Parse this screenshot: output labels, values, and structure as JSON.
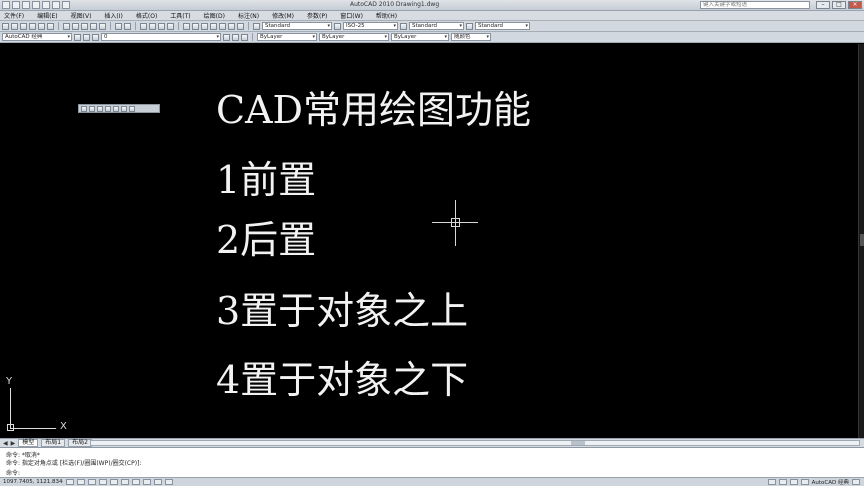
{
  "titlebar": {
    "title": "AutoCAD 2010 Drawing1.dwg",
    "search_placeholder": "键入关键字或短语"
  },
  "menu": [
    "文件(F)",
    "编辑(E)",
    "视图(V)",
    "插入(I)",
    "格式(O)",
    "工具(T)",
    "绘图(D)",
    "标注(N)",
    "修改(M)",
    "参数(P)",
    "窗口(W)",
    "帮助(H)"
  ],
  "toolbar1": {
    "text_style": "Standard",
    "dim_style": "ISO-25",
    "table_style": "Standard",
    "mleader_style": "Standard"
  },
  "toolbar2": {
    "workspace": "AutoCAD 经典",
    "layer": "0",
    "color": "ByLayer",
    "linetype": "ByLayer",
    "lineweight": "ByLayer",
    "plotstyle": "随颜色"
  },
  "canvas": {
    "line1": "CAD常用绘图功能",
    "line2": "1前置",
    "line3": "2后置",
    "line4": "3置于对象之上",
    "line5": "4置于对象之下",
    "ucs_x": "X",
    "ucs_y": "Y"
  },
  "tabs": {
    "model": "模型",
    "layout1": "布局1",
    "layout2": "布局2"
  },
  "command": {
    "line1": "命令: *取消*",
    "line2": "命令: 指定对角点或 [栏选(F)/圈围(WP)/圈交(CP)]:",
    "prompt": "命令:"
  },
  "status": {
    "coords": "1097.7405, 1121.8340",
    "workspace_label": "AutoCAD 经典"
  },
  "colors": {
    "canvas_bg": "#000000",
    "canvas_text": "#f2f2f2",
    "chrome_bg": "#d2d8df"
  }
}
